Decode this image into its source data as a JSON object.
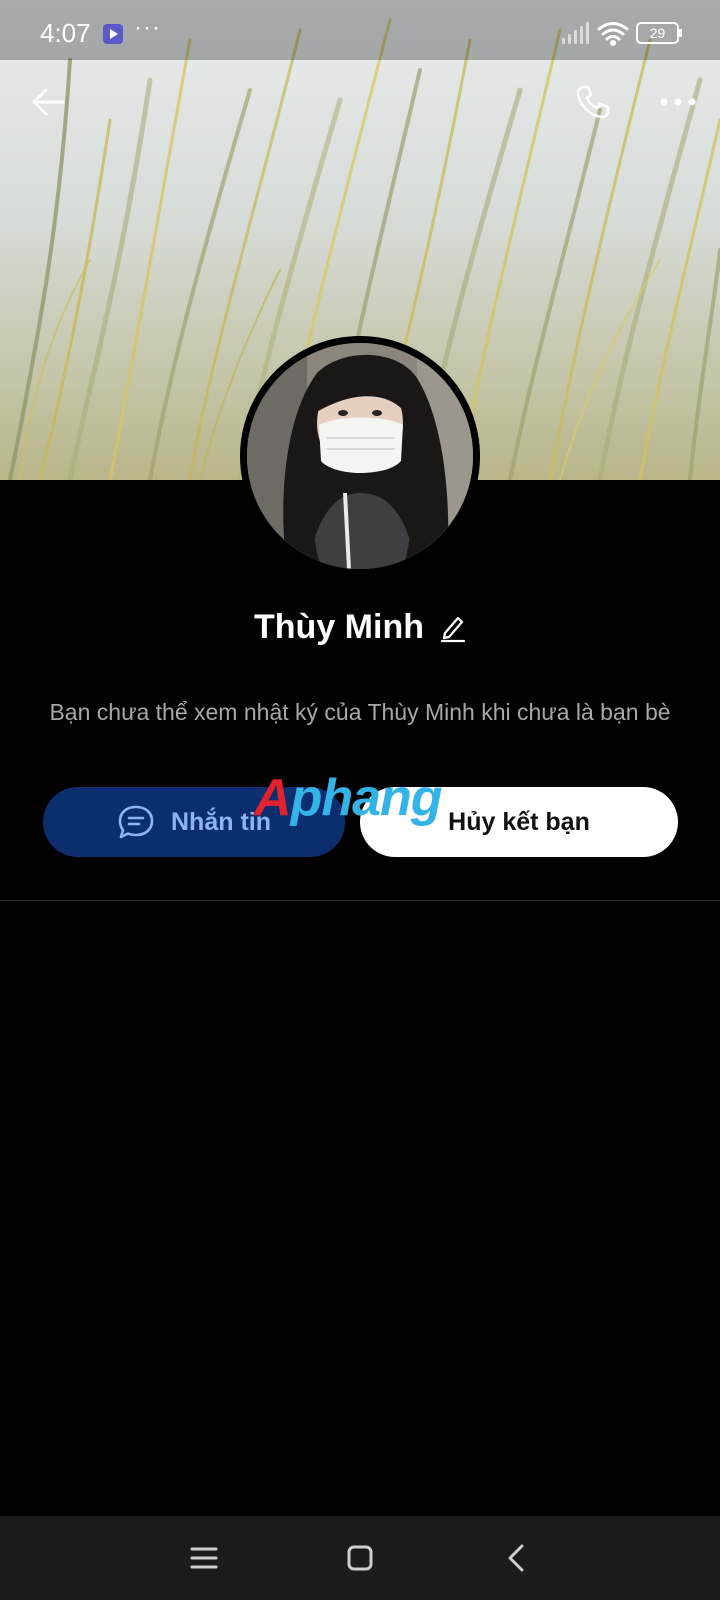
{
  "status_bar": {
    "time": "4:07",
    "more": "···",
    "battery": "29"
  },
  "header": {
    "back_icon": "arrow-left-icon",
    "call_icon": "phone-icon",
    "more_icon": "more-horizontal-icon"
  },
  "profile": {
    "name": "Thùy Minh",
    "notice": "Bạn chưa thể xem nhật ký của Thùy Minh khi chưa là bạn bè"
  },
  "actions": {
    "message_label": "Nhắn tin",
    "unfriend_label": "Hủy kết bạn"
  },
  "watermark": {
    "part1": "A",
    "part2": "phang"
  },
  "colors": {
    "message_bg": "#0d2e6e",
    "message_text": "#8fb3f5",
    "unfriend_bg": "#ffffff",
    "background": "#000000"
  },
  "nav": {
    "menu_icon": "menu-icon",
    "home_icon": "home-square-icon",
    "back_icon": "chevron-left-icon"
  }
}
